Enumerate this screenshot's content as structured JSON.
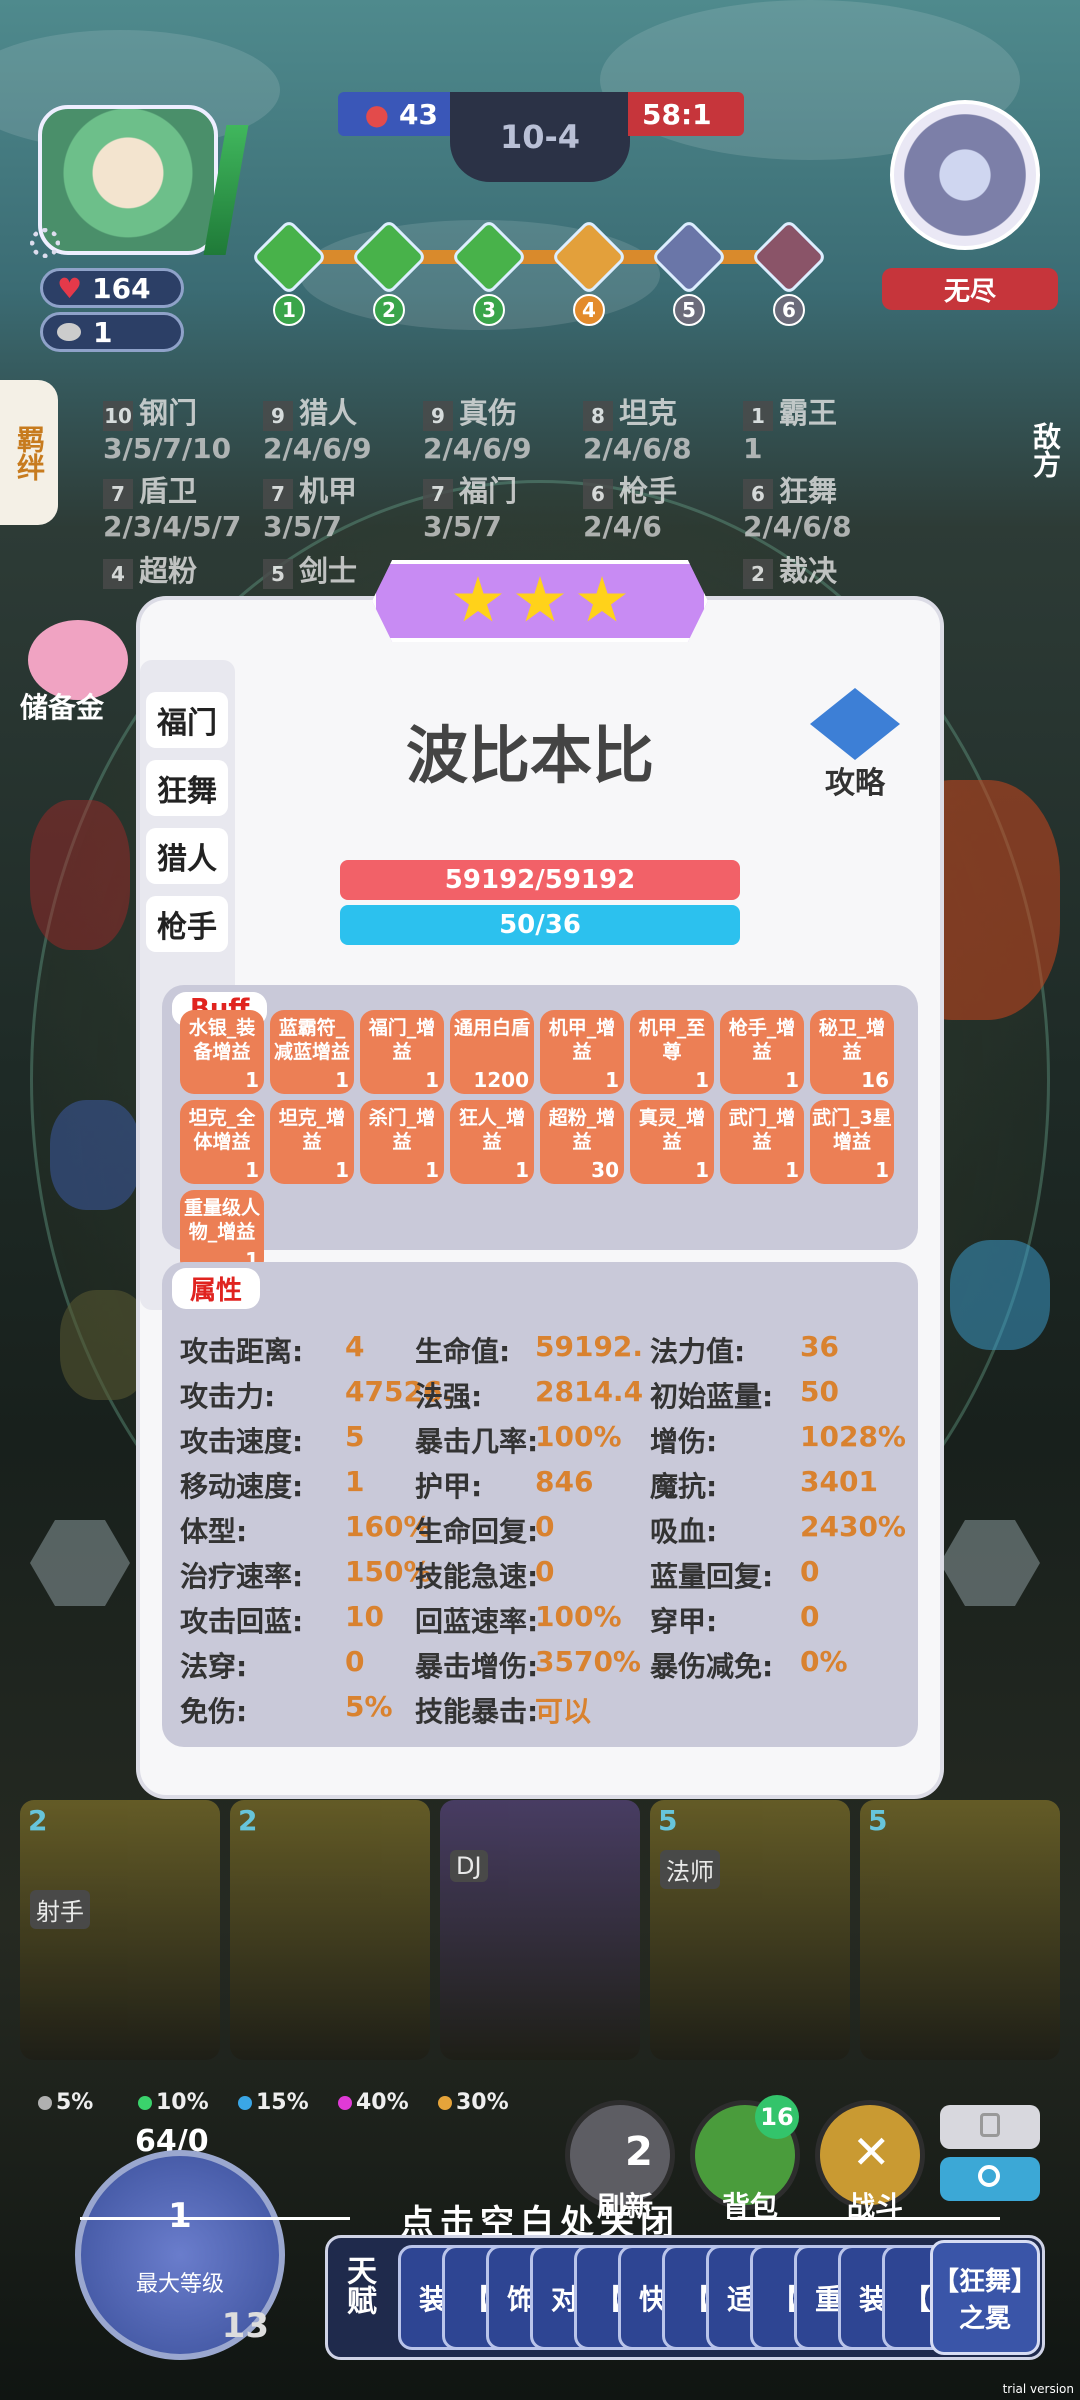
{
  "hud": {
    "hp": "164",
    "coins": "1",
    "score_left": "43",
    "round": "10-4",
    "score_right": "58:1",
    "stages": [
      "1",
      "2",
      "3",
      "4",
      "5",
      "6"
    ],
    "enemy_mode": "无尽",
    "left_tab": "羁绊",
    "right_tab": "敌方",
    "savings_label": "储备金"
  },
  "synergies": [
    {
      "num": "10",
      "name": "钢门",
      "tiers": "3/5/7/10"
    },
    {
      "num": "9",
      "name": "猎人",
      "tiers": "2/4/6/9"
    },
    {
      "num": "9",
      "name": "真伤",
      "tiers": "2/4/6/9"
    },
    {
      "num": "8",
      "name": "坦克",
      "tiers": "2/4/6/8"
    },
    {
      "num": "1",
      "name": "霸王",
      "tiers": "1"
    },
    {
      "num": "7",
      "name": "盾卫",
      "tiers": "2/3/4/5/7"
    },
    {
      "num": "7",
      "name": "机甲",
      "tiers": "3/5/7"
    },
    {
      "num": "7",
      "name": "福门",
      "tiers": "3/5/7"
    },
    {
      "num": "6",
      "name": "枪手",
      "tiers": "2/4/6"
    },
    {
      "num": "6",
      "name": "狂舞",
      "tiers": "2/4/6/8"
    },
    {
      "num": "4",
      "name": "超粉",
      "tiers": ""
    },
    {
      "num": "5",
      "name": "剑士",
      "tiers": ""
    },
    {
      "num": "2",
      "name": "裁决",
      "tiers": ""
    }
  ],
  "modal": {
    "hero_name": "波比本比",
    "guide_label": "攻略",
    "hp_text": "59192/59192",
    "mp_text": "50/36",
    "hp_ratio": 1.0,
    "mp_ratio": 1.0,
    "side_tabs": [
      "福门",
      "狂舞",
      "猎人",
      "枪手"
    ],
    "buff_tag": "Buff",
    "attr_tag": "属性",
    "buffs": [
      {
        "name": "水银_装备增益",
        "count": "1"
      },
      {
        "name": "蓝霸符_减蓝增益",
        "count": "1"
      },
      {
        "name": "福门_增益",
        "count": "1"
      },
      {
        "name": "通用白盾",
        "count": "1200"
      },
      {
        "name": "机甲_增益",
        "count": "1"
      },
      {
        "name": "机甲_至尊",
        "count": "1"
      },
      {
        "name": "枪手_增益",
        "count": "1"
      },
      {
        "name": "秘卫_增益",
        "count": "16"
      },
      {
        "name": "坦克_全体增益",
        "count": "1"
      },
      {
        "name": "坦克_增益",
        "count": "1"
      },
      {
        "name": "杀门_增益",
        "count": "1"
      },
      {
        "name": "狂人_增益",
        "count": "1"
      },
      {
        "name": "超粉_增益",
        "count": "30"
      },
      {
        "name": "真灵_增益",
        "count": "1"
      },
      {
        "name": "武门_增益",
        "count": "1"
      },
      {
        "name": "武门_3星增益",
        "count": "1"
      },
      {
        "name": "重量级人物_增益",
        "count": "1"
      }
    ],
    "attributes": [
      {
        "k": "攻击距离:",
        "v": "4"
      },
      {
        "k": "生命值:",
        "v": "59192."
      },
      {
        "k": "法力值:",
        "v": "36"
      },
      {
        "k": "攻击力:",
        "v": "47526."
      },
      {
        "k": "法强:",
        "v": "2814.4"
      },
      {
        "k": "初始蓝量:",
        "v": "50"
      },
      {
        "k": "攻击速度:",
        "v": "5"
      },
      {
        "k": "暴击几率:",
        "v": "100%"
      },
      {
        "k": "增伤:",
        "v": "1028%"
      },
      {
        "k": "移动速度:",
        "v": "1"
      },
      {
        "k": "护甲:",
        "v": "846"
      },
      {
        "k": "魔抗:",
        "v": "3401"
      },
      {
        "k": "体型:",
        "v": "160%"
      },
      {
        "k": "生命回复:",
        "v": "0"
      },
      {
        "k": "吸血:",
        "v": "2430%"
      },
      {
        "k": "治疗速率:",
        "v": "150%"
      },
      {
        "k": "技能急速:",
        "v": "0"
      },
      {
        "k": "蓝量回复:",
        "v": "0"
      },
      {
        "k": "攻击回蓝:",
        "v": "10"
      },
      {
        "k": "回蓝速率:",
        "v": "100%"
      },
      {
        "k": "穿甲:",
        "v": "0"
      },
      {
        "k": "法穿:",
        "v": "0"
      },
      {
        "k": "暴击增伤:",
        "v": "3570%"
      },
      {
        "k": "暴伤减免:",
        "v": "0%"
      },
      {
        "k": "免伤:",
        "v": "5%"
      },
      {
        "k": "技能暴击:",
        "v": "可以"
      }
    ]
  },
  "shop": {
    "cards": [
      {
        "cost": "2",
        "role": "射手"
      },
      {
        "cost": "2",
        "role": ""
      },
      {
        "cost": "",
        "role": "DJ"
      },
      {
        "cost": "5",
        "role": "法师"
      },
      {
        "cost": "5",
        "role": ""
      }
    ],
    "odds": [
      {
        "pct": "5%",
        "color": "#b0b0b0"
      },
      {
        "pct": "10%",
        "color": "#3ad36c"
      },
      {
        "pct": "15%",
        "color": "#3aa6e6"
      },
      {
        "pct": "40%",
        "color": "#e03ad6"
      },
      {
        "pct": "30%",
        "color": "#e6a43a"
      }
    ],
    "xp": "64/0",
    "level": "1",
    "level_label": "最大等级",
    "level_coins": "13",
    "refresh_cost": "2",
    "refresh_label": "刷新",
    "bag_label": "背包",
    "bag_badge": "16",
    "fight_label": "战斗",
    "close_hint": "点击空白处关闭",
    "talent_label": "天赋",
    "talent_cards": [
      "装",
      "【",
      "饰",
      "对",
      "【",
      "快",
      "【",
      "适",
      "【",
      "重",
      "装",
      "【"
    ],
    "talent_last": "【狂舞】之冕"
  },
  "footer": {
    "trial": "trial version"
  },
  "colors": {
    "hp": "#f26168",
    "mp": "#2cc1ee",
    "buff": "#ec7f55",
    "attr_value": "#d9822f",
    "tag_text": "#e0231f"
  }
}
